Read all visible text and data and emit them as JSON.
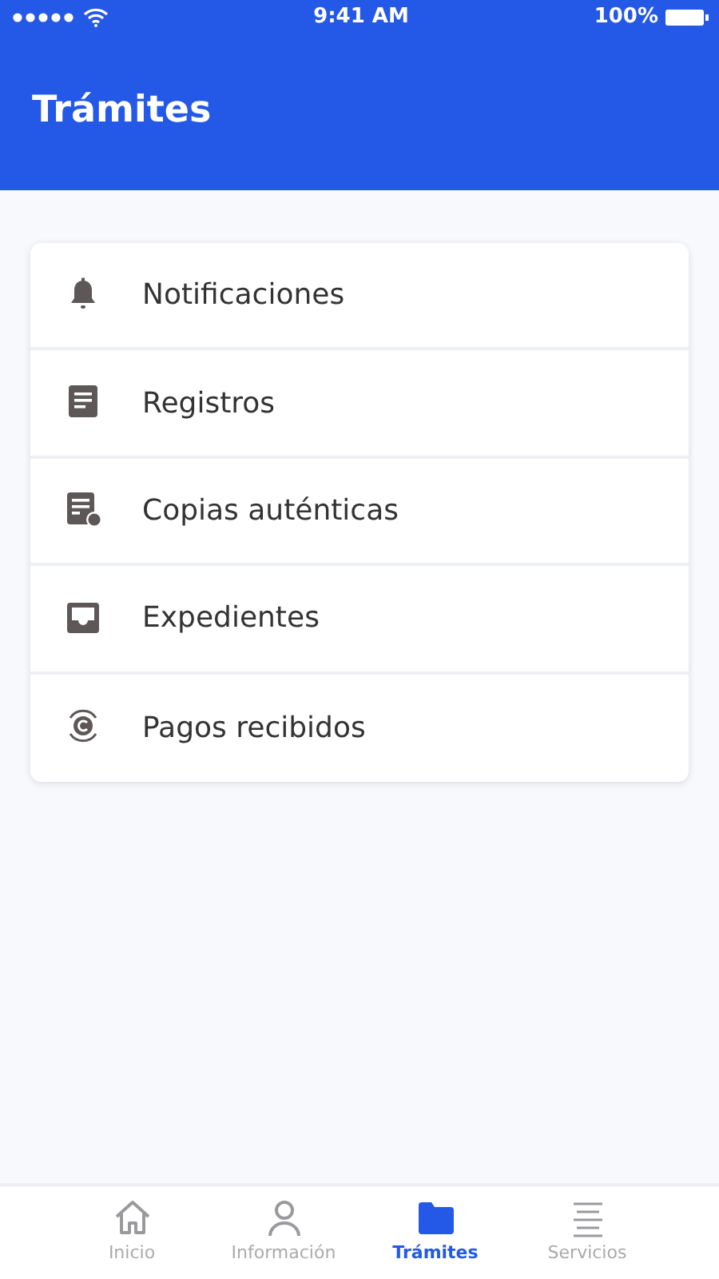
{
  "status_bar": {
    "time": "9:41 AM",
    "battery": "100%"
  },
  "header": {
    "title": "Trámites"
  },
  "menu": [
    {
      "label": "Notificaciones"
    },
    {
      "label": "Registros"
    },
    {
      "label": "Copias auténticas"
    },
    {
      "label": "Expedientes"
    },
    {
      "label": "Pagos recibidos"
    }
  ],
  "tab_bar": [
    {
      "label": "Inicio",
      "selected": false
    },
    {
      "label": "Información",
      "selected": false
    },
    {
      "label": "Trámites",
      "selected": true
    },
    {
      "label": "Servicios",
      "selected": false
    }
  ]
}
